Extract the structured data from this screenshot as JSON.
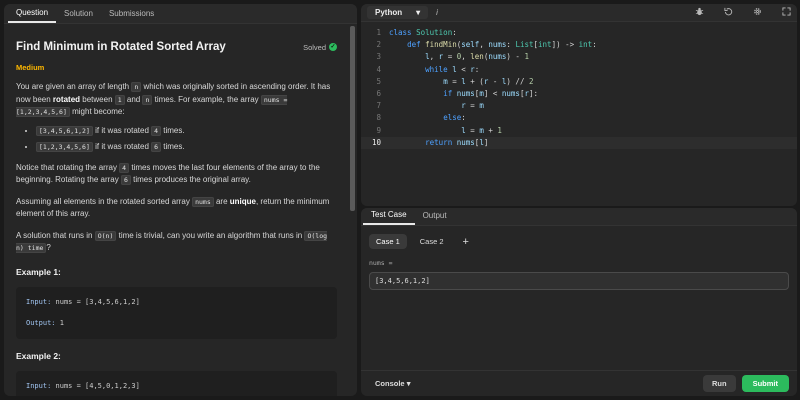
{
  "left_tabs": [
    "Question",
    "Solution",
    "Submissions"
  ],
  "problem": {
    "title": "Find Minimum in Rotated Sorted Array",
    "solved_label": "Solved",
    "difficulty": "Medium",
    "p1_a": "You are given an array of length ",
    "p1_n1": "n",
    "p1_b": " which was originally sorted in ascending order. It has now been ",
    "p1_rotated": "rotated",
    "p1_c": " between ",
    "p1_one": "1",
    "p1_d": " and ",
    "p1_n2": "n",
    "p1_e": " times. For example, the array ",
    "p1_arr": "nums = [1,2,3,4,5,6]",
    "p1_f": " might become:",
    "bullet1_code": "[3,4,5,6,1,2]",
    "bullet1_a": " if it was rotated ",
    "bullet1_num": "4",
    "bullet1_b": " times.",
    "bullet2_code": "[1,2,3,4,5,6]",
    "bullet2_a": " if it was rotated ",
    "bullet2_num": "6",
    "bullet2_b": " times.",
    "p2_a": "Notice that rotating the array ",
    "p2_num1": "4",
    "p2_b": " times moves the last four elements of the array to the beginning. Rotating the array ",
    "p2_num2": "6",
    "p2_c": " times produces the original array.",
    "p3_a": "Assuming all elements in the rotated sorted array ",
    "p3_code": "nums",
    "p3_b": " are ",
    "p3_unique": "unique",
    "p3_c": ", return the minimum element of this array.",
    "p4_a": "A solution that runs in ",
    "p4_code1": "O(n)",
    "p4_b": " time is trivial, can you write an algorithm that runs in ",
    "p4_code2": "O(log n) time",
    "p4_c": "?",
    "example1_title": "Example 1:",
    "example1_input_label": "Input:",
    "example1_input": " nums = [3,4,5,6,1,2]",
    "example1_output_label": "Output:",
    "example1_output": " 1",
    "example2_title": "Example 2:",
    "example2_input_label": "Input:",
    "example2_input": " nums = [4,5,0,1,2,3]"
  },
  "editor": {
    "language": "Python",
    "info_icon": "i",
    "line_numbers": [
      "1",
      "2",
      "3",
      "4",
      "5",
      "6",
      "7",
      "8",
      "9",
      "10"
    ],
    "current_line": 10
  },
  "bottom": {
    "tabs": [
      "Test Case",
      "Output"
    ],
    "cases": [
      "Case 1",
      "Case 2"
    ],
    "add_label": "+",
    "input_label": "nums =",
    "input_value": "[3,4,5,6,1,2]",
    "console_label": "Console",
    "run_label": "Run",
    "submit_label": "Submit"
  },
  "colors": {
    "accent_green": "#2cbb5d",
    "medium": "#ffb800",
    "keyword": "#4ea1ff"
  }
}
